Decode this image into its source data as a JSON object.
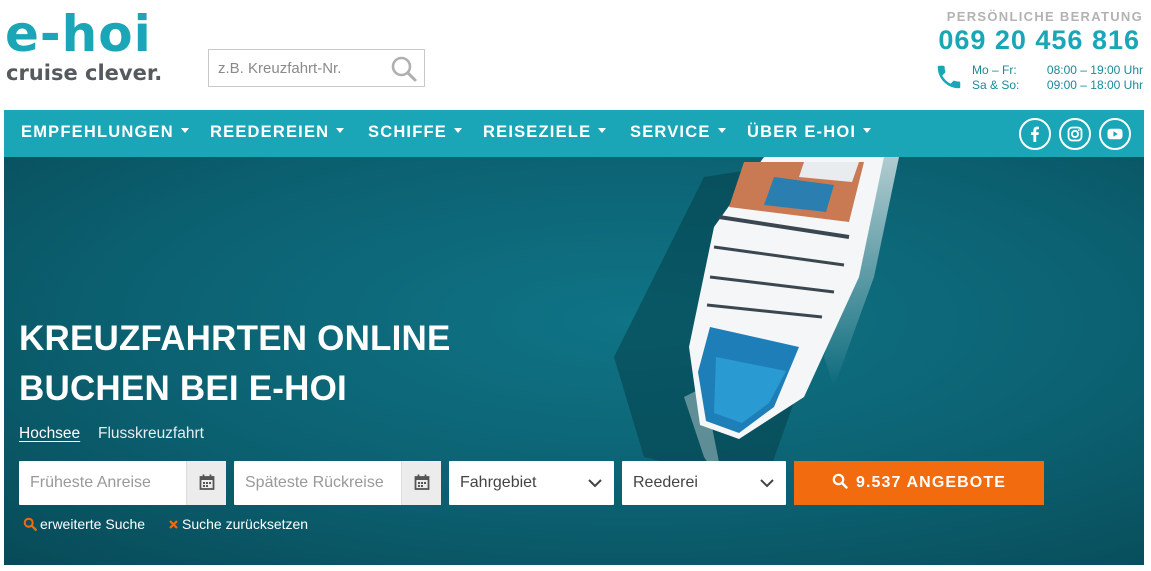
{
  "brand": {
    "logo_main": "e-hoi",
    "logo_sub": "cruise clever.",
    "primary_color": "#1aa6b7",
    "cta_color": "#f26b0f"
  },
  "header_search": {
    "placeholder": "z.B. Kreuzfahrt-Nr.",
    "icon": "search-icon"
  },
  "contact": {
    "label": "PERSÖNLICHE BERATUNG",
    "phone": "069 20 456 816",
    "icon": "phone-icon",
    "weekday_label": "Mo – Fr:",
    "weekday_hours": "08:00 – 19:00 Uhr",
    "weekend_label": "Sa & So:",
    "weekend_hours": "09:00 – 18:00 Uhr"
  },
  "nav": {
    "items": [
      {
        "label": "EMPFEHLUNGEN"
      },
      {
        "label": "REEDEREIEN"
      },
      {
        "label": "SCHIFFE"
      },
      {
        "label": "REISEZIELE"
      },
      {
        "label": "SERVICE"
      },
      {
        "label": "ÜBER E-HOI"
      }
    ],
    "social": [
      "facebook-icon",
      "instagram-icon",
      "youtube-icon"
    ]
  },
  "hero": {
    "title_line1": "KREUZFAHRTEN ONLINE",
    "title_line2": "BUCHEN BEI E-HOI",
    "tabs": [
      {
        "label": "Hochsee",
        "active": true
      },
      {
        "label": "Flusskreuzfahrt",
        "active": false
      }
    ],
    "search": {
      "arrival_placeholder": "Früheste Anreise",
      "return_placeholder": "Späteste Rückreise",
      "region_label": "Fahrgebiet",
      "shipping_company_label": "Reederei",
      "cta_label": "9.537 ANGEBOTE"
    },
    "links": {
      "advanced": "erweiterte Suche",
      "reset": "Suche zurücksetzen"
    }
  }
}
